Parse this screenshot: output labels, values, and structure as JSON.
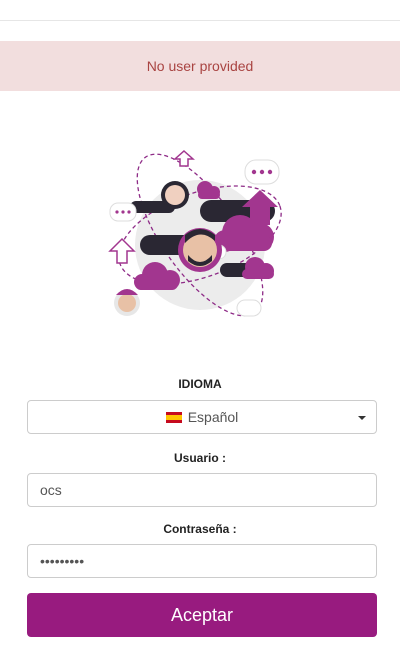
{
  "alert": {
    "message": "No user provided"
  },
  "language": {
    "label": "IDIOMA",
    "selected": "Español",
    "flag_icon": "spain-flag-icon"
  },
  "username": {
    "label": "Usuario :",
    "value": "ocs"
  },
  "password": {
    "label": "Contraseña :",
    "value": "•••••••••"
  },
  "submit": {
    "label": "Aceptar"
  },
  "colors": {
    "brand": "#981b7f",
    "alert_bg": "#f2dede",
    "alert_text": "#a94442"
  }
}
